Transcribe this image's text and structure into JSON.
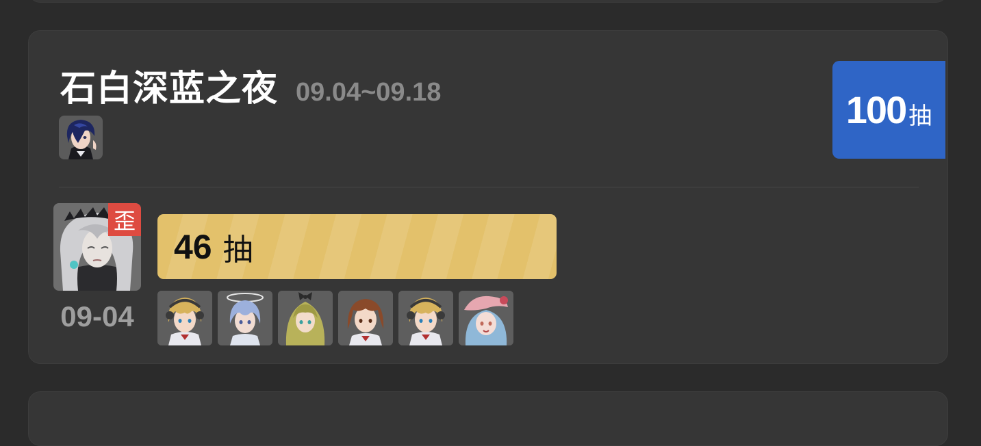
{
  "pool": {
    "title": "石白深蓝之夜",
    "dates": "09.04~09.18",
    "total_pulls": "100",
    "total_unit": "抽",
    "accent_color": "#2f65c6"
  },
  "five_star": {
    "pulls": "46",
    "pulls_unit": "抽",
    "lost_fifty_fifty_label": "歪",
    "date": "09-04",
    "bar_color": "#e3c16b",
    "tag_color": "#de4b41"
  },
  "four_stars": [
    {
      "icon": "blonde-headband-character"
    },
    {
      "icon": "blue-hair-halo-character"
    },
    {
      "icon": "green-hair-bow-character"
    },
    {
      "icon": "brown-hair-character"
    },
    {
      "icon": "blonde-headband-character"
    },
    {
      "icon": "pink-hat-character"
    }
  ]
}
